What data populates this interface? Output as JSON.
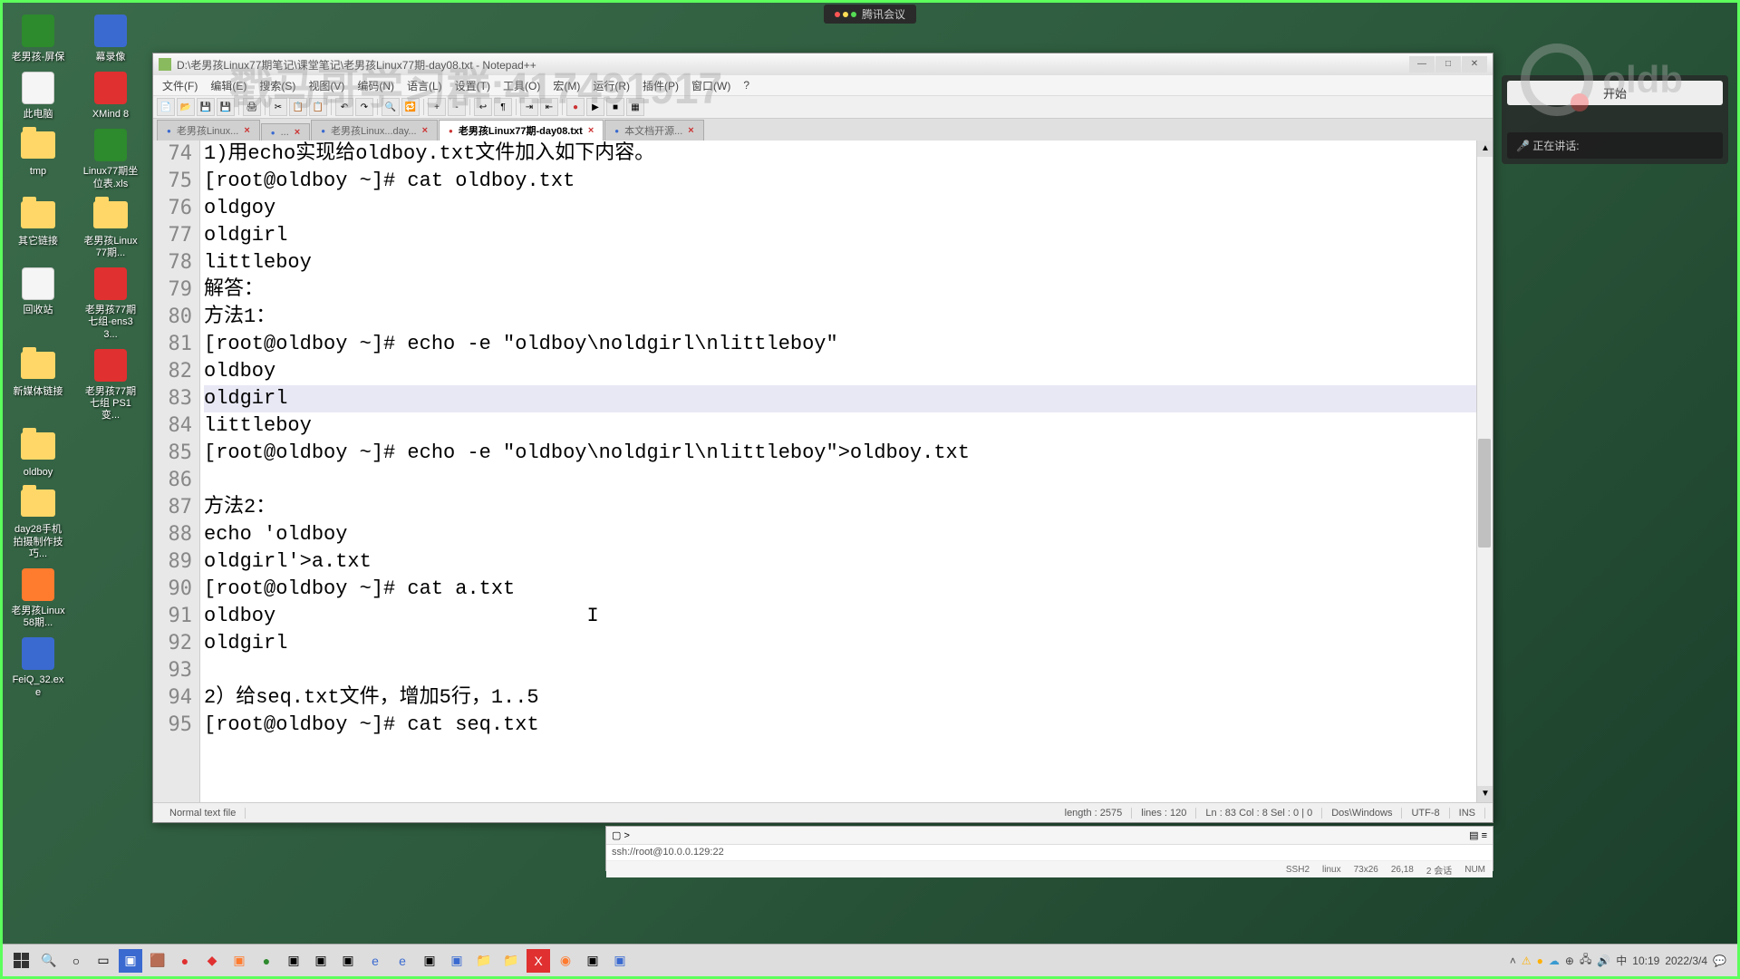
{
  "top_badge": "腾讯会议",
  "watermark": {
    "text": "戳马哥学习群:417491917",
    "brand": "oldb"
  },
  "desktop": [
    [
      {
        "label": "老男孩-屏保",
        "type": "green"
      },
      {
        "label": "幕录像",
        "type": "blue"
      }
    ],
    [
      {
        "label": "此电脑",
        "type": "white"
      },
      {
        "label": "XMind 8",
        "type": "red"
      }
    ],
    [
      {
        "label": "tmp",
        "type": "folder"
      },
      {
        "label": "Linux77期坐位表.xls",
        "type": "green"
      }
    ],
    [
      {
        "label": "其它链接",
        "type": "folder"
      },
      {
        "label": "老男孩Linux77期...",
        "type": "folder"
      }
    ],
    [
      {
        "label": "回收站",
        "type": "white"
      },
      {
        "label": "老男孩77期七组-ens33...",
        "type": "red"
      }
    ],
    [
      {
        "label": "新媒体链接",
        "type": "folder"
      },
      {
        "label": "老男孩77期七组 PS1变...",
        "type": "red"
      }
    ],
    [
      {
        "label": "oldboy",
        "type": "folder"
      },
      {
        "label": "",
        "type": ""
      }
    ],
    [
      {
        "label": "day28手机拍摄制作技巧...",
        "type": "folder"
      },
      {
        "label": "",
        "type": ""
      }
    ],
    [
      {
        "label": "老男孩Linux58期...",
        "type": "orange"
      },
      {
        "label": "",
        "type": ""
      }
    ],
    [
      {
        "label": "FeiQ_32.exe",
        "type": "blue"
      },
      {
        "label": "",
        "type": ""
      }
    ]
  ],
  "editor": {
    "title": "D:\\老男孩Linux77期笔记\\课堂笔记\\老男孩Linux77期-day08.txt - Notepad++",
    "menus": [
      "文件(F)",
      "编辑(E)",
      "搜索(S)",
      "视图(V)",
      "编码(N)",
      "语言(L)",
      "设置(T)",
      "工具(O)",
      "宏(M)",
      "运行(R)",
      "插件(P)",
      "窗口(W)",
      "?"
    ],
    "tabs": [
      {
        "label": "老男孩Linux...",
        "active": false
      },
      {
        "label": "...",
        "active": false
      },
      {
        "label": "老男孩Linux...day...",
        "active": false
      },
      {
        "label": "老男孩Linux77期-day08.txt",
        "active": true
      },
      {
        "label": "本文档开源...",
        "active": false
      }
    ],
    "lines": [
      {
        "n": "74",
        "t": "1)用echo实现给oldboy.txt文件加入如下内容。"
      },
      {
        "n": "75",
        "t": "[root@oldboy ~]# cat oldboy.txt"
      },
      {
        "n": "76",
        "t": "oldgoy"
      },
      {
        "n": "77",
        "t": "oldgirl"
      },
      {
        "n": "78",
        "t": "littleboy"
      },
      {
        "n": "79",
        "t": "解答："
      },
      {
        "n": "80",
        "t": "方法1："
      },
      {
        "n": "81",
        "t": "[root@oldboy ~]# echo -e \"oldboy\\noldgirl\\nlittleboy\""
      },
      {
        "n": "82",
        "t": "oldboy"
      },
      {
        "n": "83",
        "t": "oldgirl",
        "hl": true
      },
      {
        "n": "84",
        "t": "littleboy"
      },
      {
        "n": "85",
        "t": "[root@oldboy ~]# echo -e \"oldboy\\noldgirl\\nlittleboy\">oldboy.txt"
      },
      {
        "n": "86",
        "t": ""
      },
      {
        "n": "87",
        "t": "方法2："
      },
      {
        "n": "88",
        "t": "echo 'oldboy"
      },
      {
        "n": "89",
        "t": "oldgirl'>a.txt"
      },
      {
        "n": "90",
        "t": "[root@oldboy ~]# cat a.txt"
      },
      {
        "n": "91",
        "t": "oldboy                          I"
      },
      {
        "n": "92",
        "t": "oldgirl"
      },
      {
        "n": "93",
        "t": ""
      },
      {
        "n": "94",
        "t": "2）给seq.txt文件，增加5行，1..5"
      },
      {
        "n": "95",
        "t": "[root@oldboy ~]# cat seq.txt"
      }
    ],
    "status": {
      "filetype": "Normal text file",
      "length": "length : 2575",
      "lines": "lines : 120",
      "pos": "Ln : 83    Col : 8    Sel : 0 | 0",
      "eol": "Dos\\Windows",
      "enc": "UTF-8",
      "ins": "INS"
    }
  },
  "terminal": {
    "addr": "ssh://root@10.0.0.129:22",
    "status": [
      "SSH2",
      "linux",
      "73x26",
      "26,18",
      "2 会话",
      "NUM"
    ]
  },
  "right_widget": {
    "button": "开始",
    "status_label": "正在讲话:",
    "status_value": ""
  },
  "taskbar": {
    "time": "10:19",
    "date": "2022/3/4"
  }
}
